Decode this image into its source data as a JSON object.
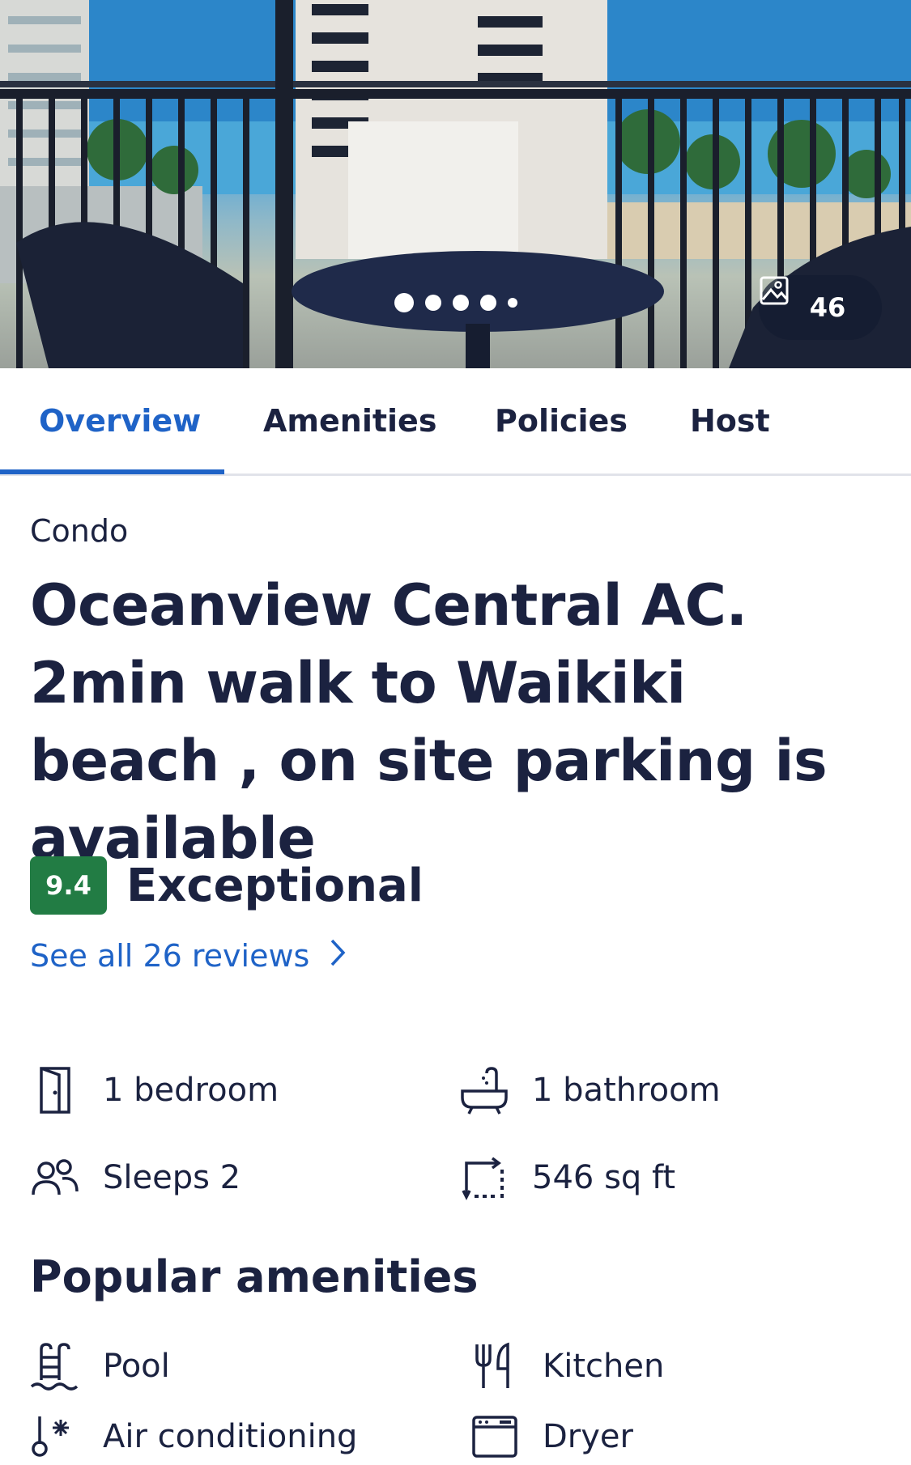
{
  "hero": {
    "photo_count": "46",
    "carousel_dots": 5
  },
  "tabs": [
    {
      "label": "Overview",
      "active": true
    },
    {
      "label": "Amenities",
      "active": false
    },
    {
      "label": "Policies",
      "active": false
    },
    {
      "label": "Host",
      "active": false
    }
  ],
  "property": {
    "category": "Condo",
    "title": "Oceanview Central AC. 2min walk to Waikiki beach , on site parking is available"
  },
  "rating": {
    "score": "9.4",
    "label": "Exceptional",
    "reviews_link": "See all 26 reviews"
  },
  "facts": {
    "bedroom": "1 bedroom",
    "bathroom": "1 bathroom",
    "sleeps": "Sleeps 2",
    "area": "546 sq ft"
  },
  "amenities": {
    "title": "Popular amenities",
    "items": [
      {
        "label": "Pool",
        "icon": "pool-icon"
      },
      {
        "label": "Kitchen",
        "icon": "kitchen-icon"
      },
      {
        "label": "Air conditioning",
        "icon": "air-conditioning-icon"
      },
      {
        "label": "Dryer",
        "icon": "dryer-icon"
      }
    ]
  },
  "colors": {
    "accent": "#1f63c7",
    "text": "#1b2240",
    "score_badge": "#227c44"
  }
}
